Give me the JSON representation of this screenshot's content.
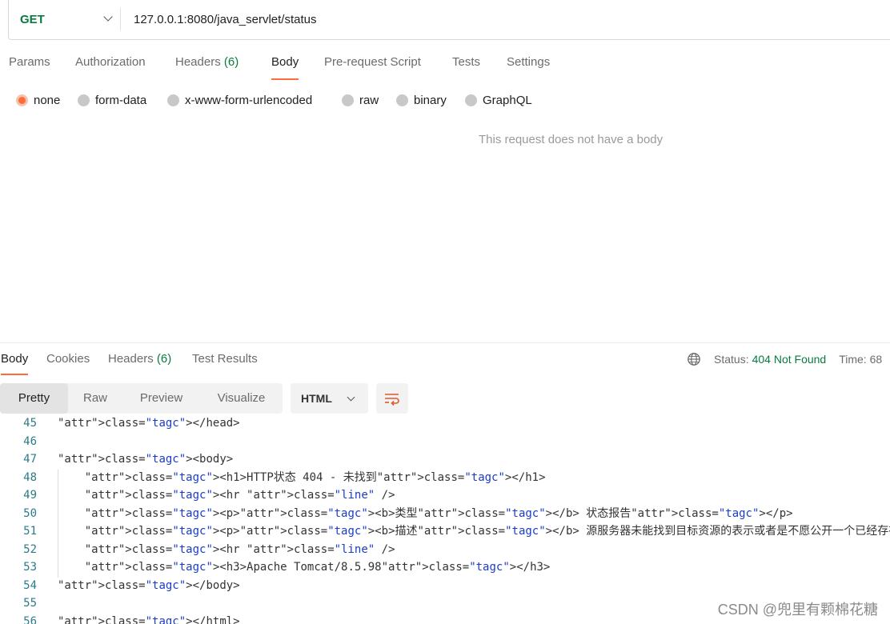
{
  "request": {
    "method": "GET",
    "url": "127.0.0.1:8080/java_servlet/status"
  },
  "request_tabs": [
    {
      "label": "Params",
      "count": ""
    },
    {
      "label": "Authorization",
      "count": ""
    },
    {
      "label": "Headers",
      "count": "(6)"
    },
    {
      "label": "Body",
      "count": ""
    },
    {
      "label": "Pre-request Script",
      "count": ""
    },
    {
      "label": "Tests",
      "count": ""
    },
    {
      "label": "Settings",
      "count": ""
    }
  ],
  "body_types": [
    {
      "label": "none",
      "selected": true
    },
    {
      "label": "form-data",
      "selected": false
    },
    {
      "label": "x-www-form-urlencoded",
      "selected": false
    },
    {
      "label": "raw",
      "selected": false
    },
    {
      "label": "binary",
      "selected": false
    },
    {
      "label": "GraphQL",
      "selected": false
    }
  ],
  "empty_body_message": "This request does not have a body",
  "response_tabs": [
    {
      "label": "Body",
      "count": ""
    },
    {
      "label": "Cookies",
      "count": ""
    },
    {
      "label": "Headers",
      "count": "(6)"
    },
    {
      "label": "Test Results",
      "count": ""
    }
  ],
  "status": {
    "label": "Status:",
    "value": "404 Not Found",
    "time_label": "Time: 68"
  },
  "view_modes": [
    "Pretty",
    "Raw",
    "Preview",
    "Visualize"
  ],
  "format": "HTML",
  "code_lines": [
    {
      "n": "45",
      "text": "</head>"
    },
    {
      "n": "46",
      "text": ""
    },
    {
      "n": "47",
      "text": "<body>"
    },
    {
      "n": "48",
      "text": "    <h1>HTTP状态 404 - 未找到</h1>"
    },
    {
      "n": "49",
      "text": "    <hr class=\"line\" />"
    },
    {
      "n": "50",
      "text": "    <p><b>类型</b> 状态报告</p>"
    },
    {
      "n": "51",
      "text": "    <p><b>描述</b> 源服务器未能找到目标资源的表示或者是不愿公开一个已经存在的资源表示。</p>"
    },
    {
      "n": "52",
      "text": "    <hr class=\"line\" />"
    },
    {
      "n": "53",
      "text": "    <h3>Apache Tomcat/8.5.98</h3>"
    },
    {
      "n": "54",
      "text": "</body>"
    },
    {
      "n": "55",
      "text": ""
    },
    {
      "n": "56",
      "text": "</html>"
    }
  ],
  "watermark": "CSDN @兜里有颗棉花糖"
}
